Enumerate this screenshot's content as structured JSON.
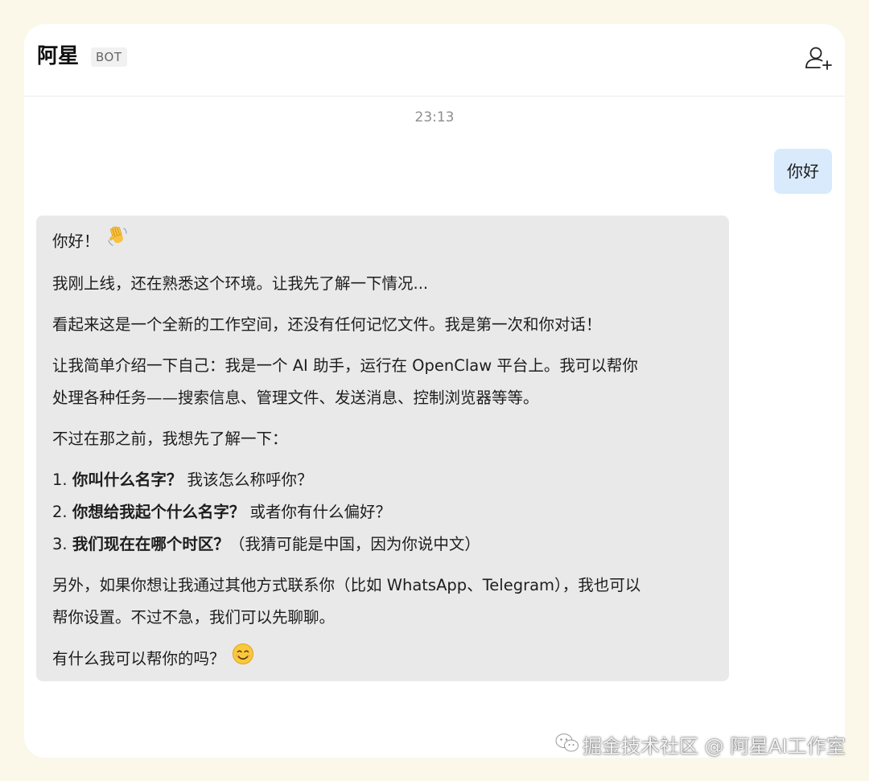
{
  "header": {
    "title": "阿星",
    "badge": "BOT",
    "add_member_icon": "add-person-icon"
  },
  "conversation": {
    "timestamp": "23:13",
    "user_message": "你好",
    "bot_message": {
      "greeting": "你好！",
      "greeting_emoji": "waving-hand-emoji",
      "p1": "我刚上线，还在熟悉这个环境。让我先了解一下情况...",
      "p2": "看起来这是一个全新的工作空间，还没有任何记忆文件。我是第一次和你对话！",
      "p3_line1": "让我简单介绍一下自己：我是一个 AI 助手，运行在 OpenClaw 平台上。我可以帮你",
      "p3_line2": "处理各种任务——搜索信息、管理文件、发送消息、控制浏览器等等。",
      "p4": "不过在那之前，我想先了解一下：",
      "list": [
        {
          "num": "1.",
          "bold": "你叫什么名字？",
          "rest": "我该怎么称呼你？"
        },
        {
          "num": "2.",
          "bold": "你想给我起个什么名字？",
          "rest": "或者你有什么偏好？"
        },
        {
          "num": "3.",
          "bold": "我们现在在哪个时区？",
          "rest": "（我猜可能是中国，因为你说中文）"
        }
      ],
      "p5_line1": "另外，如果你想让我通过其他方式联系你（比如 WhatsApp、Telegram），我也可以",
      "p5_line2": "帮你设置。不过不急，我们可以先聊聊。",
      "closing": "有什么我可以帮你的吗？",
      "closing_emoji": "smiling-face-emoji"
    }
  },
  "watermark": {
    "text": "掘金技术社区 @ 阿星AI工作室",
    "icon": "wechat-icon"
  },
  "colors": {
    "background": "#fbf8ea",
    "user_bubble": "#d8eafb",
    "bot_bubble": "#e9e9e9"
  }
}
